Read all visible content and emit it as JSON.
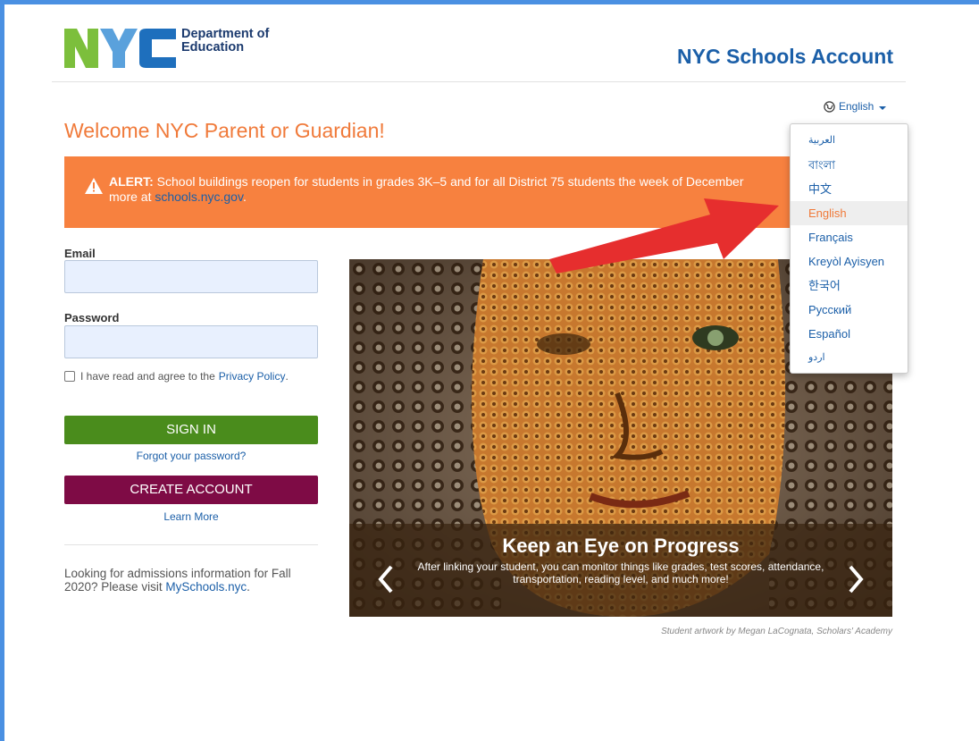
{
  "colors": {
    "frame": "#4a90e2",
    "title_blue": "#1b5fa8",
    "accent_orange": "#f07a3a",
    "alert_bg": "#f7813f",
    "sign_in": "#4a8c1c",
    "create_account": "#7e0b45",
    "annotation_red": "#e62e2e"
  },
  "header": {
    "logo_text_line1": "Department of",
    "logo_text_line2": "Education",
    "app_title": "NYC Schools Account"
  },
  "language": {
    "selected": "English",
    "options": [
      "العربية",
      "বাংলা",
      "中文",
      "English",
      "Français",
      "Kreyòl Ayisyen",
      "한국어",
      "Русский",
      "Español",
      "اردو"
    ]
  },
  "welcome": "Welcome NYC Parent or Guardian!",
  "alert": {
    "label": "ALERT:",
    "text": " School buildings reopen for students in grades 3K–5 and for all District 75 students the week of December",
    "line2_prefix": "more at ",
    "link": "schools.nyc.gov",
    "line2_suffix": "."
  },
  "form": {
    "email_label": "Email",
    "email_value": "",
    "password_label": "Password",
    "password_value": "",
    "agree_text": "I have read and agree to the",
    "privacy_link": "Privacy Policy",
    "agree_suffix": ".",
    "sign_in": "SIGN IN",
    "forgot": "Forgot your password?",
    "create_account": "CREATE ACCOUNT",
    "learn_more": "Learn More",
    "admissions_text": "Looking for admissions information for Fall 2020? Please visit ",
    "admissions_link": "MySchools.nyc",
    "admissions_suffix": "."
  },
  "hero": {
    "title": "Keep an Eye on Progress",
    "text": "After linking your student, you can monitor things like grades, test scores, attendance, transportation, reading level, and much more!",
    "credit": "Student artwork by Megan LaCognata, Scholars' Academy"
  }
}
